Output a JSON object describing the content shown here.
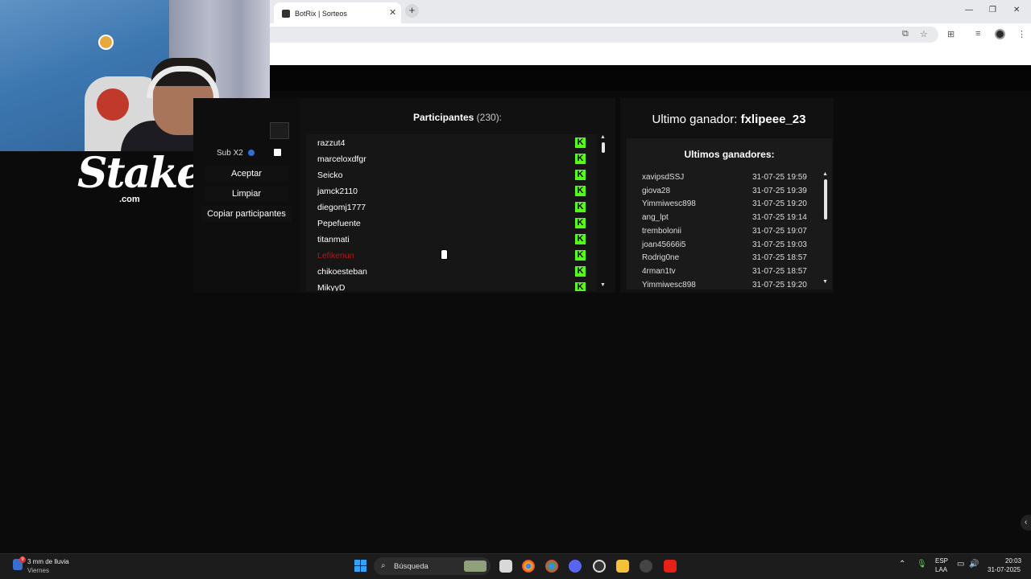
{
  "browser": {
    "tab_title": "BotRix | Sorteos",
    "tab_close": "✕",
    "new_tab": "+",
    "window_controls": [
      "—",
      "❐",
      "✕"
    ],
    "toolbar_icons": [
      "translate-icon",
      "star-icon",
      "extensions-icon",
      "media-icon",
      "profile-icon",
      "menu-icon"
    ]
  },
  "overlay": {
    "sponsor_logo": "Stake",
    "sponsor_logo_suffix": ".com"
  },
  "left_panel": {
    "sub_label": "Sub X2",
    "sub_checked": false,
    "buttons": [
      "Aceptar",
      "Limpiar",
      "Copiar participantes"
    ]
  },
  "participants": {
    "title": "Participantes",
    "count": "(230):",
    "platform_badge": "K",
    "list": [
      {
        "name": "razzut4",
        "color": "#ffffff"
      },
      {
        "name": "marceloxdfgr",
        "color": "#ffffff"
      },
      {
        "name": "Seicko",
        "color": "#ffffff"
      },
      {
        "name": "jamck2110",
        "color": "#ffffff"
      },
      {
        "name": "diegomj1777",
        "color": "#ffffff"
      },
      {
        "name": "Pepefuente",
        "color": "#ffffff"
      },
      {
        "name": "titanmati",
        "color": "#ffffff"
      },
      {
        "name": "Lefikenun",
        "color": "#b31818"
      },
      {
        "name": "chikoesteban",
        "color": "#ffffff"
      },
      {
        "name": "MikyyD",
        "color": "#ffffff"
      }
    ],
    "accent": "#53fc18"
  },
  "winner": {
    "label": "Ultimo ganador:",
    "name": "fxlipeee_23",
    "history_title": "Ultimos ganadores:",
    "history": [
      {
        "name": "xavipsdSSJ",
        "date": "31-07-25 19:59"
      },
      {
        "name": "giova28",
        "date": "31-07-25 19:39"
      },
      {
        "name": "Yimmiwesc898",
        "date": "31-07-25 19:20"
      },
      {
        "name": "ang_lpt",
        "date": "31-07-25 19:14"
      },
      {
        "name": "trembolonii",
        "date": "31-07-25 19:07"
      },
      {
        "name": "joan45666i5",
        "date": "31-07-25 19:03"
      },
      {
        "name": "Rodrig0ne",
        "date": "31-07-25 18:57"
      },
      {
        "name": "4rman1tv",
        "date": "31-07-25 18:57"
      },
      {
        "name": "Yimmiwesc898",
        "date": "31-07-25 19:20"
      }
    ]
  },
  "taskbar": {
    "weather_title": "3 mm de lluvia",
    "weather_sub": "Viernes",
    "weather_badge": "9",
    "search_label": "Búsqueda",
    "apps": [
      "file-explorer-icon",
      "chrome-icon",
      "chrome-profile-icon",
      "discord-icon",
      "obs-icon",
      "folder-icon",
      "media-player-icon",
      "youtube-icon"
    ],
    "lang": "ESP",
    "lang_sub": "LAA",
    "time": "20:03",
    "date": "31-07-2025"
  }
}
